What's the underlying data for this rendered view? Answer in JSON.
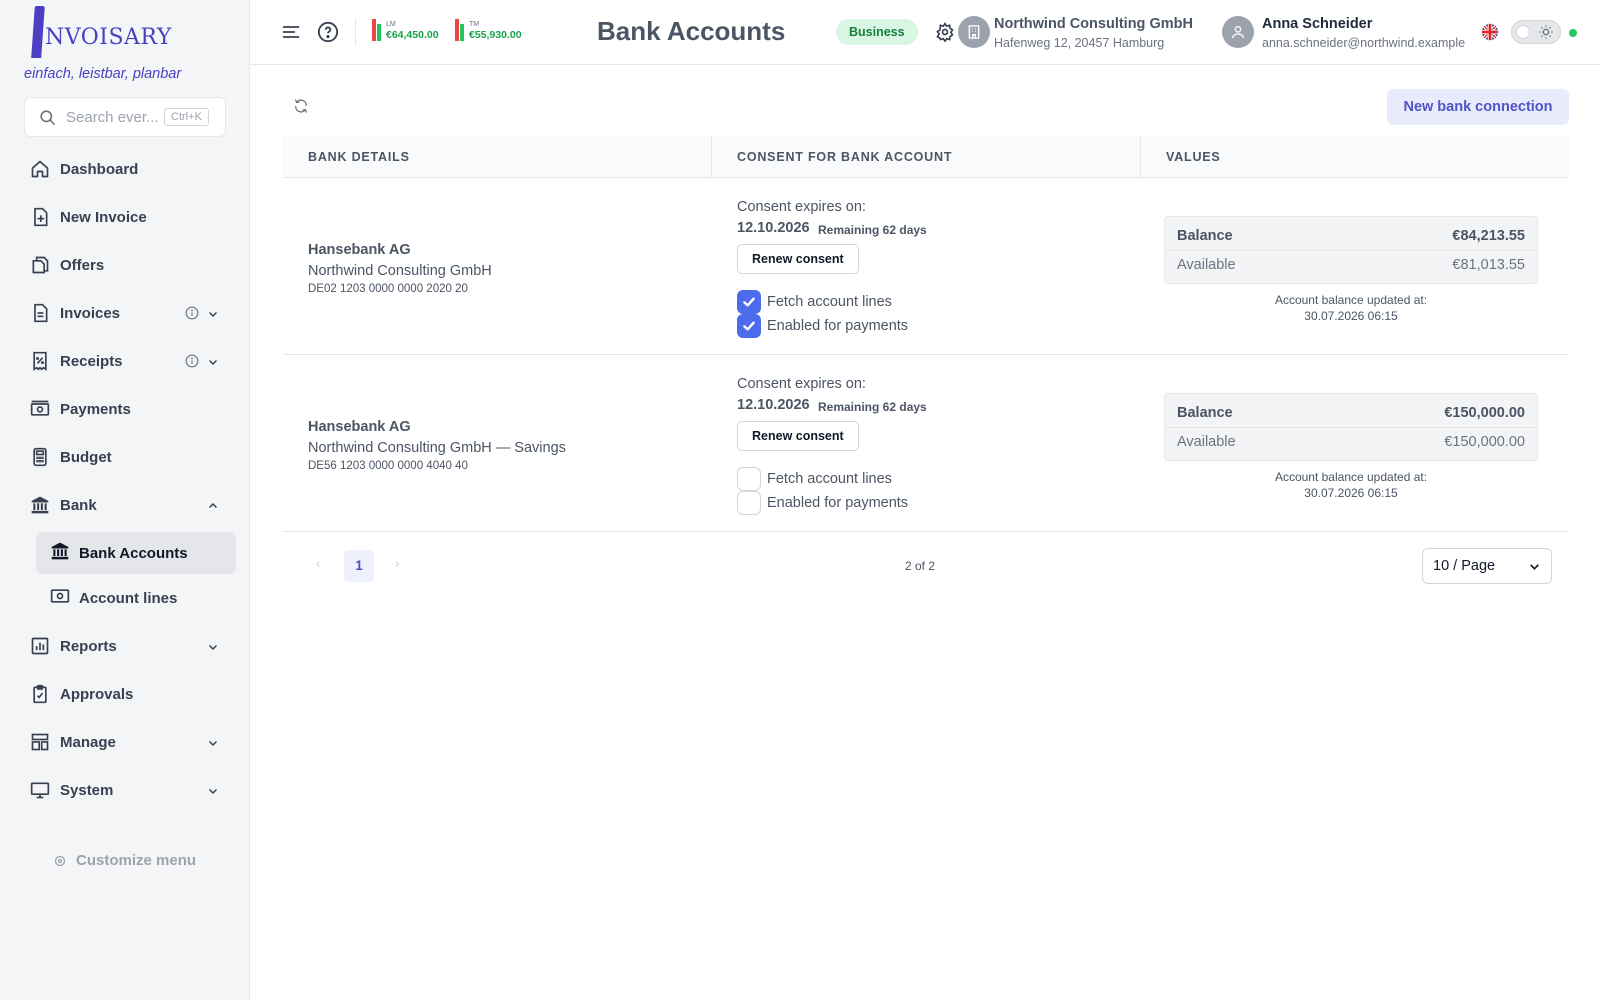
{
  "brand": {
    "logo_text": "NVOISARY",
    "tagline": "einfach, leistbar, planbar"
  },
  "search": {
    "placeholder": "Search ever...",
    "shortcut": "Ctrl+K"
  },
  "sidebar": {
    "items": [
      {
        "label": "Dashboard",
        "icon": "home-icon"
      },
      {
        "label": "New Invoice",
        "icon": "file-plus-icon"
      },
      {
        "label": "Offers",
        "icon": "copy-icon"
      },
      {
        "label": "Invoices",
        "icon": "file-icon"
      },
      {
        "label": "Receipts",
        "icon": "receipt-icon"
      },
      {
        "label": "Payments",
        "icon": "banknote-icon"
      },
      {
        "label": "Budget",
        "icon": "calculator-icon"
      },
      {
        "label": "Bank",
        "icon": "bank-icon"
      },
      {
        "label": "Reports",
        "icon": "bar-chart-icon"
      },
      {
        "label": "Approvals",
        "icon": "clipboard-check-icon"
      },
      {
        "label": "Manage",
        "icon": "layout-icon"
      },
      {
        "label": "System",
        "icon": "monitor-icon"
      }
    ],
    "bank_sub": [
      {
        "label": "Bank Accounts",
        "icon": "bank-icon",
        "active": true
      },
      {
        "label": "Account lines",
        "icon": "banknote-icon",
        "active": false
      }
    ],
    "customize_label": "Customize menu"
  },
  "topbar": {
    "kpis": [
      {
        "label": "LM",
        "value": "€64,450.00"
      },
      {
        "label": "TM",
        "value": "€55,930.00"
      }
    ],
    "page_title": "Bank Accounts",
    "mode_badge": "Business",
    "company": {
      "name": "Northwind Consulting GmbH",
      "address": "Hafenweg 12, 20457 Hamburg"
    },
    "user": {
      "name": "Anna Schneider",
      "email": "anna.schneider@northwind.example"
    },
    "language": "en-GB"
  },
  "main": {
    "new_connection_label": "New bank connection",
    "columns": [
      "BANK DETAILS",
      "CONSENT FOR BANK ACCOUNT",
      "VALUES"
    ],
    "accounts": [
      {
        "bank": "Hansebank AG",
        "account_name": "Northwind Consulting GmbH",
        "iban": "DE02 1203 0000 0000 2020 20",
        "consent_label": "Consent expires on:",
        "consent_date": "12.10.2026",
        "remaining": "Remaining 62 days",
        "renew_label": "Renew consent",
        "fetch_label": "Fetch account lines",
        "fetch_checked": true,
        "payments_label": "Enabled for payments",
        "payments_checked": true,
        "balance_label": "Balance",
        "balance": "€84,213.55",
        "available_label": "Available",
        "available": "€81,013.55",
        "updated_label": "Account balance updated at:",
        "updated_at": "30.07.2026 06:15"
      },
      {
        "bank": "Hansebank AG",
        "account_name": "Northwind Consulting GmbH — Savings",
        "iban": "DE56 1203 0000 0000 4040 40",
        "consent_label": "Consent expires on:",
        "consent_date": "12.10.2026",
        "remaining": "Remaining 62 days",
        "renew_label": "Renew consent",
        "fetch_label": "Fetch account lines",
        "fetch_checked": false,
        "payments_label": "Enabled for payments",
        "payments_checked": false,
        "balance_label": "Balance",
        "balance": "€150,000.00",
        "available_label": "Available",
        "available": "€150,000.00",
        "updated_label": "Account balance updated at:",
        "updated_at": "30.07.2026 06:15"
      }
    ],
    "pagination": {
      "current": "1",
      "count_text": "2 of 2",
      "per_page": "10 / Page"
    }
  },
  "colors": {
    "brand": "#4b3fc2",
    "accent": "#4f6bed",
    "positive": "#16a34a",
    "business_badge": "#d9f5e3"
  }
}
